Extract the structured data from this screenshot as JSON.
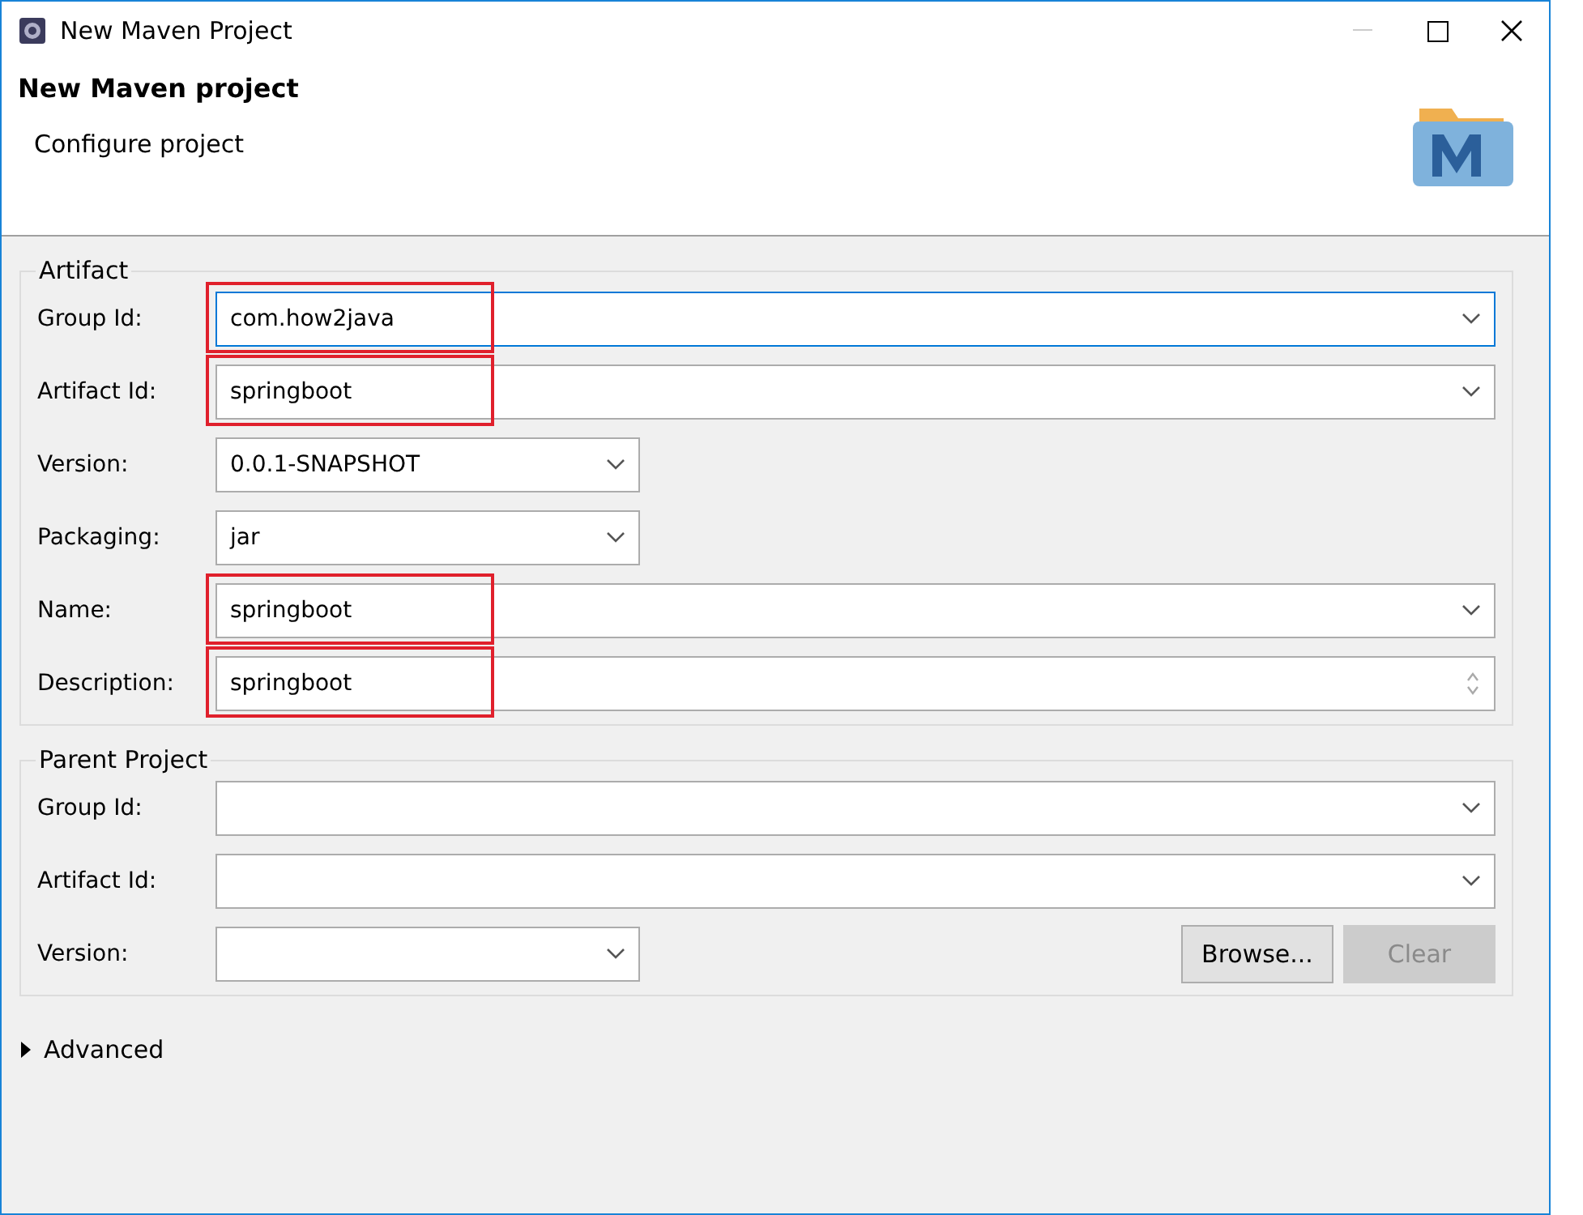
{
  "window": {
    "title": "New Maven Project"
  },
  "header": {
    "title": "New Maven project",
    "subtitle": "Configure project"
  },
  "artifact": {
    "legend": "Artifact",
    "fields": [
      {
        "label": "Group Id:",
        "value": "com.how2java",
        "kind": "combo",
        "focused": true,
        "highlighted": true
      },
      {
        "label": "Artifact Id:",
        "value": "springboot",
        "kind": "combo",
        "focused": false,
        "highlighted": true
      },
      {
        "label": "Version:",
        "value": "0.0.1-SNAPSHOT",
        "kind": "short-combo",
        "focused": false,
        "highlighted": false
      },
      {
        "label": "Packaging:",
        "value": "jar",
        "kind": "short-combo",
        "focused": false,
        "highlighted": false
      },
      {
        "label": "Name:",
        "value": "springboot",
        "kind": "combo",
        "focused": false,
        "highlighted": true
      },
      {
        "label": "Description:",
        "value": "springboot",
        "kind": "spinner",
        "focused": false,
        "highlighted": true
      }
    ]
  },
  "parent": {
    "legend": "Parent Project",
    "fields": [
      {
        "label": "Group Id:",
        "kind": "combo"
      },
      {
        "label": "Artifact Id:",
        "kind": "combo"
      },
      {
        "label": "Version:",
        "kind": "short-combo"
      }
    ],
    "buttons": [
      {
        "label": "Browse...",
        "disabled": false
      },
      {
        "label": "Clear",
        "disabled": true
      }
    ]
  },
  "advanced": {
    "label": "Advanced",
    "expanded": false
  }
}
